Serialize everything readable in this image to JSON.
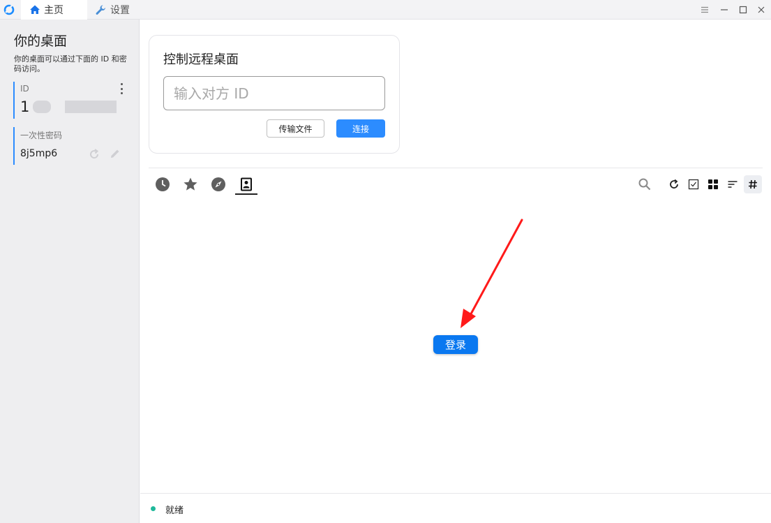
{
  "titlebar": {
    "tabs": [
      {
        "label": "主页",
        "icon": "home-icon",
        "active": true
      },
      {
        "label": "设置",
        "icon": "wrench-icon",
        "active": false
      }
    ],
    "controls": [
      "menu-icon",
      "minimize-icon",
      "maximize-icon",
      "close-icon"
    ]
  },
  "sidebar": {
    "title": "你的桌面",
    "description": "你的桌面可以通过下面的 ID 和密码访问。",
    "id_label": "ID",
    "id_value": "1",
    "password_label": "一次性密码",
    "password_value": "8j5mp6"
  },
  "connect": {
    "title": "控制远程桌面",
    "input_placeholder": "输入对方 ID",
    "transfer_label": "传输文件",
    "connect_label": "连接"
  },
  "peer_tabs": [
    {
      "icon": "history-icon",
      "active": false
    },
    {
      "icon": "star-icon",
      "active": false
    },
    {
      "icon": "discover-icon",
      "active": false
    },
    {
      "icon": "address-book-icon",
      "active": true
    }
  ],
  "login_label": "登录",
  "status": {
    "text": "就绪",
    "color": "#1fb89a"
  },
  "colors": {
    "accent": "#2c8cff",
    "login": "#0a78f0",
    "annotation_arrow": "#ff1a1a"
  }
}
